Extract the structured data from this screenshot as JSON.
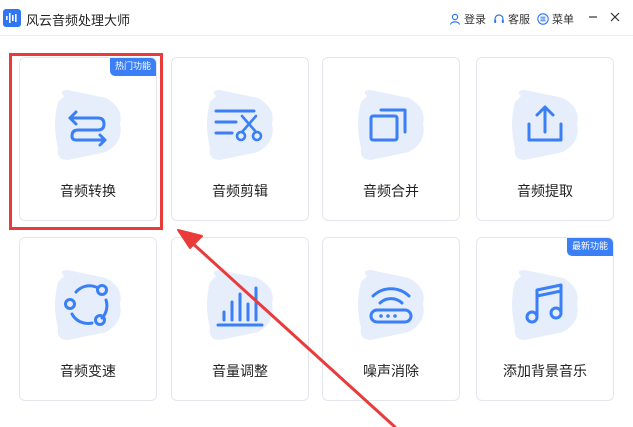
{
  "window": {
    "title": "风云音频处理大师",
    "login_label": "登录",
    "service_label": "客服",
    "menu_label": "菜单"
  },
  "colors": {
    "accent": "#3a7ff6",
    "blob": "#e6eefc",
    "highlight": "#ea3b3b"
  },
  "cards": [
    {
      "label": "音频转换",
      "icon": "convert-arrows-icon",
      "badge": "热门功能"
    },
    {
      "label": "音频剪辑",
      "icon": "scissors-icon"
    },
    {
      "label": "音频合并",
      "icon": "merge-squares-icon"
    },
    {
      "label": "音频提取",
      "icon": "upload-tray-icon"
    },
    {
      "label": "音频变速",
      "icon": "speed-dots-icon"
    },
    {
      "label": "音量调整",
      "icon": "volume-bars-icon"
    },
    {
      "label": "噪声消除",
      "icon": "wifi-router-icon"
    },
    {
      "label": "添加背景音乐",
      "icon": "music-note-icon",
      "badge": "最新功能"
    }
  ]
}
